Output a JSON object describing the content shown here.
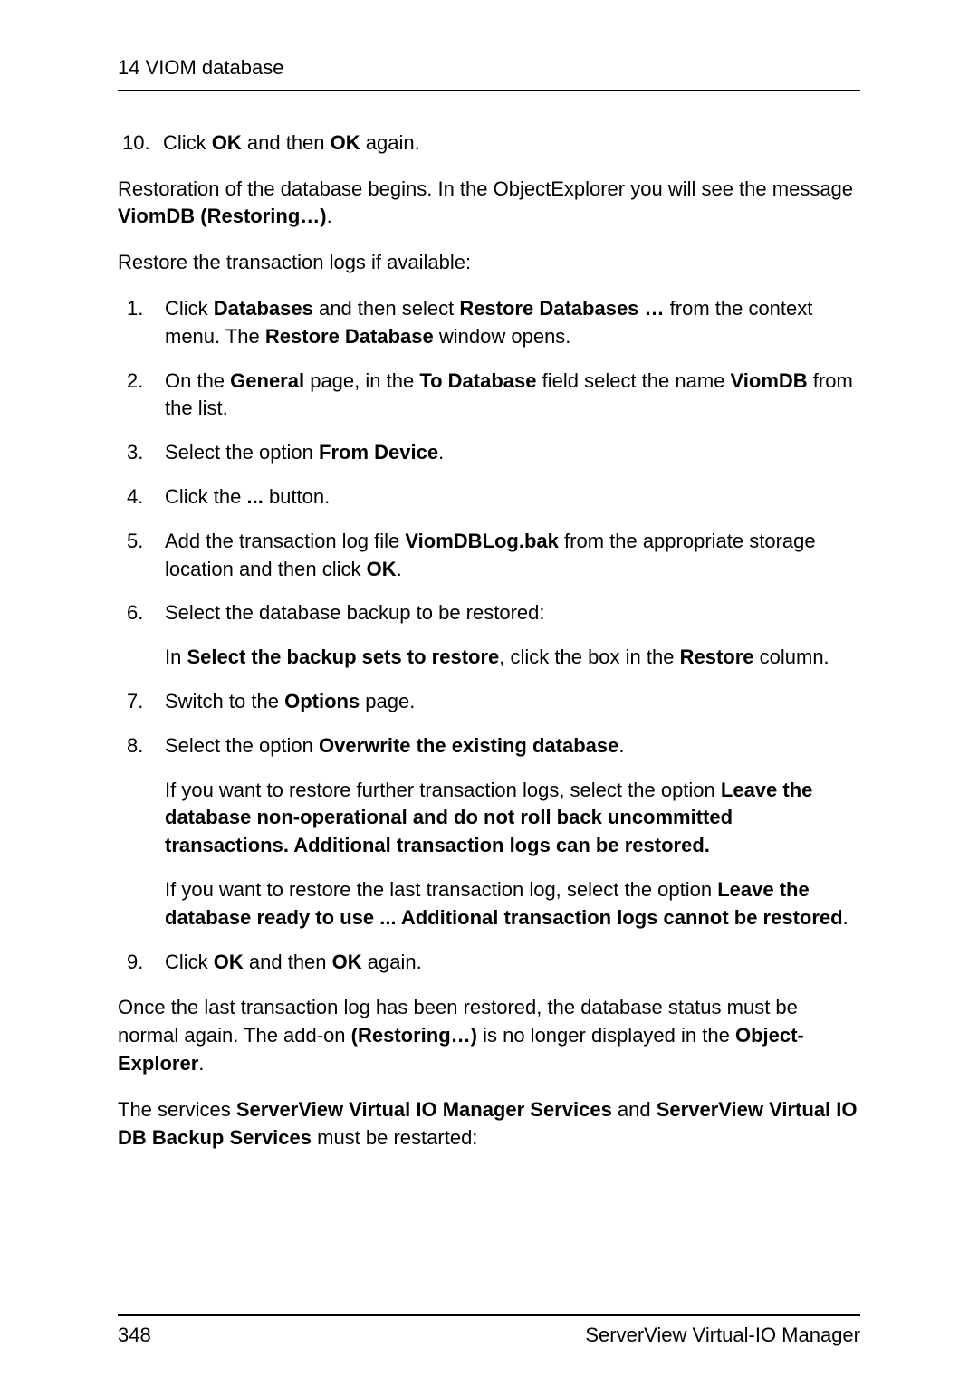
{
  "header": {
    "title": "14 VIOM database"
  },
  "step10": {
    "num": "10.",
    "p1": "Click ",
    "b1": "OK",
    "p2": " and then ",
    "b2": "OK",
    "p3": " again."
  },
  "para1": {
    "p1": "Restoration of the database begins. In the ObjectExplorer you will see the message ",
    "b1": "ViomDB (Restoring…)",
    "p2": "."
  },
  "para2": "Restore the transaction logs if available:",
  "items": [
    {
      "num": "1.",
      "p1": "Click ",
      "b1": "Databases",
      "p2": " and then select ",
      "b2": "Restore Databases …",
      "p3": " from the context menu. The ",
      "b3": "Restore Database",
      "p4": " window opens."
    },
    {
      "num": "2.",
      "p1": "On the ",
      "b1": "General",
      "p2": " page, in the ",
      "b2": "To Database",
      "p3": " field select the name ",
      "b3": "ViomDB",
      "p4": " from the list."
    },
    {
      "num": "3.",
      "p1": "Select the option ",
      "b1": "From Device",
      "p2": "."
    },
    {
      "num": "4.",
      "p1": "Click the ",
      "b1": "...",
      "p2": " button."
    },
    {
      "num": "5.",
      "p1": "Add the transaction log file ",
      "b1": "ViomDBLog.bak",
      "p2": " from the appropriate storage location and then click ",
      "b2": "OK",
      "p3": "."
    },
    {
      "num": "6.",
      "p1": "Select the database backup to be restored:",
      "sub": {
        "p1": "In ",
        "b1": "Select the backup sets to restore",
        "p2": ", click the box in the ",
        "b2": "Restore",
        "p3": " column."
      }
    },
    {
      "num": "7.",
      "p1": "Switch to the ",
      "b1": "Options",
      "p2": " page."
    },
    {
      "num": "8.",
      "p1": "Select the option ",
      "b1": "Overwrite the existing database",
      "p2": ".",
      "sub1": {
        "p1": "If you want to restore further transaction logs, select the option ",
        "b1": "Leave the database non-operational and do not roll back uncommitted transactions. Additional transaction logs can be restored."
      },
      "sub2": {
        "p1": "If you want to restore the last transaction log, select the option ",
        "b1": "Leave the database ready to use ... Additional transaction logs cannot be restored",
        "p2": "."
      }
    },
    {
      "num": "9.",
      "p1": "Click ",
      "b1": "OK",
      "p2": " and then ",
      "b2": "OK",
      "p3": " again."
    }
  ],
  "para3": {
    "p1": "Once the last transaction log has been restored, the database status must be normal again. The add-on ",
    "b1": "(Restoring…)",
    "p2": " is no longer displayed in the ",
    "b2": "Object-Explorer",
    "p3": "."
  },
  "para4": {
    "p1": "The services ",
    "b1": "ServerView Virtual IO Manager Services",
    "p2": " and ",
    "b2": "ServerView Virtual IO DB Backup Services",
    "p3": " must be restarted:"
  },
  "footer": {
    "pageNum": "348",
    "product": "ServerView Virtual-IO Manager"
  }
}
